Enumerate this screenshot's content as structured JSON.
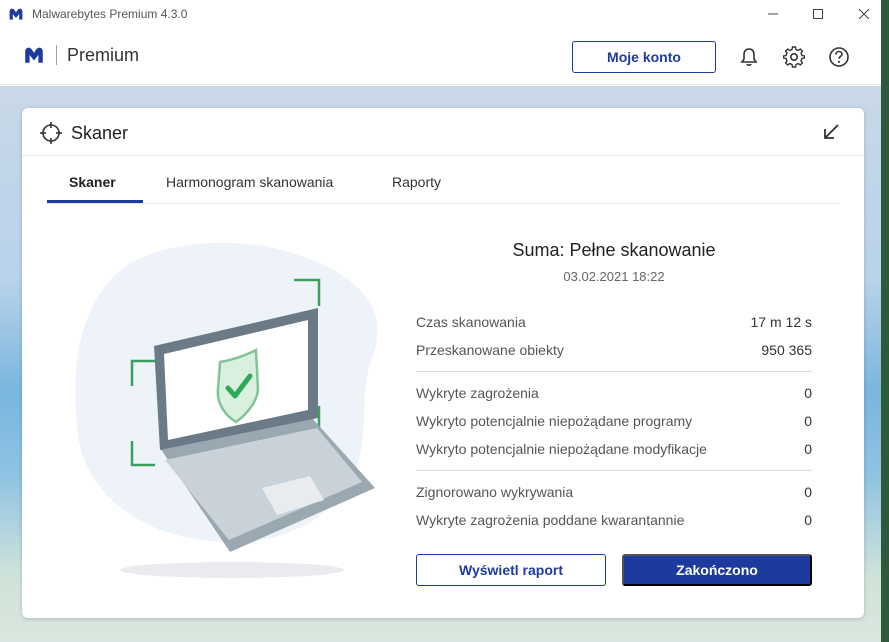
{
  "window": {
    "title": "Malwarebytes Premium  4.3.0"
  },
  "header": {
    "product": "Premium",
    "account_button": "Moje konto"
  },
  "card": {
    "title": "Skaner",
    "tabs": [
      {
        "label": "Skaner",
        "active": true
      },
      {
        "label": "Harmonogram skanowania",
        "active": false
      },
      {
        "label": "Raporty",
        "active": false
      }
    ]
  },
  "summary": {
    "title": "Suma: Pełne skanowanie",
    "date": "03.02.2021 18:22",
    "group1": [
      {
        "label": "Czas skanowania",
        "value": "17 m 12 s"
      },
      {
        "label": "Przeskanowane obiekty",
        "value": "950 365"
      }
    ],
    "group2": [
      {
        "label": "Wykryte zagrożenia",
        "value": "0"
      },
      {
        "label": "Wykryto potencjalnie niepożądane programy",
        "value": "0"
      },
      {
        "label": "Wykryto potencjalnie niepożądane modyfikacje",
        "value": "0"
      }
    ],
    "group3": [
      {
        "label": "Zignorowano wykrywania",
        "value": "0"
      },
      {
        "label": "Wykryte zagrożenia poddane kwarantannie",
        "value": "0"
      }
    ]
  },
  "buttons": {
    "view_report": "Wyświetl raport",
    "done": "Zakończono"
  },
  "colors": {
    "accent": "#1d3b9f",
    "shield_green": "#2fa85a"
  },
  "icons": [
    "malwarebytes-logo-icon",
    "minimize-icon",
    "maximize-icon",
    "close-icon",
    "bell-icon",
    "gear-icon",
    "help-icon",
    "crosshair-icon",
    "collapse-icon"
  ]
}
